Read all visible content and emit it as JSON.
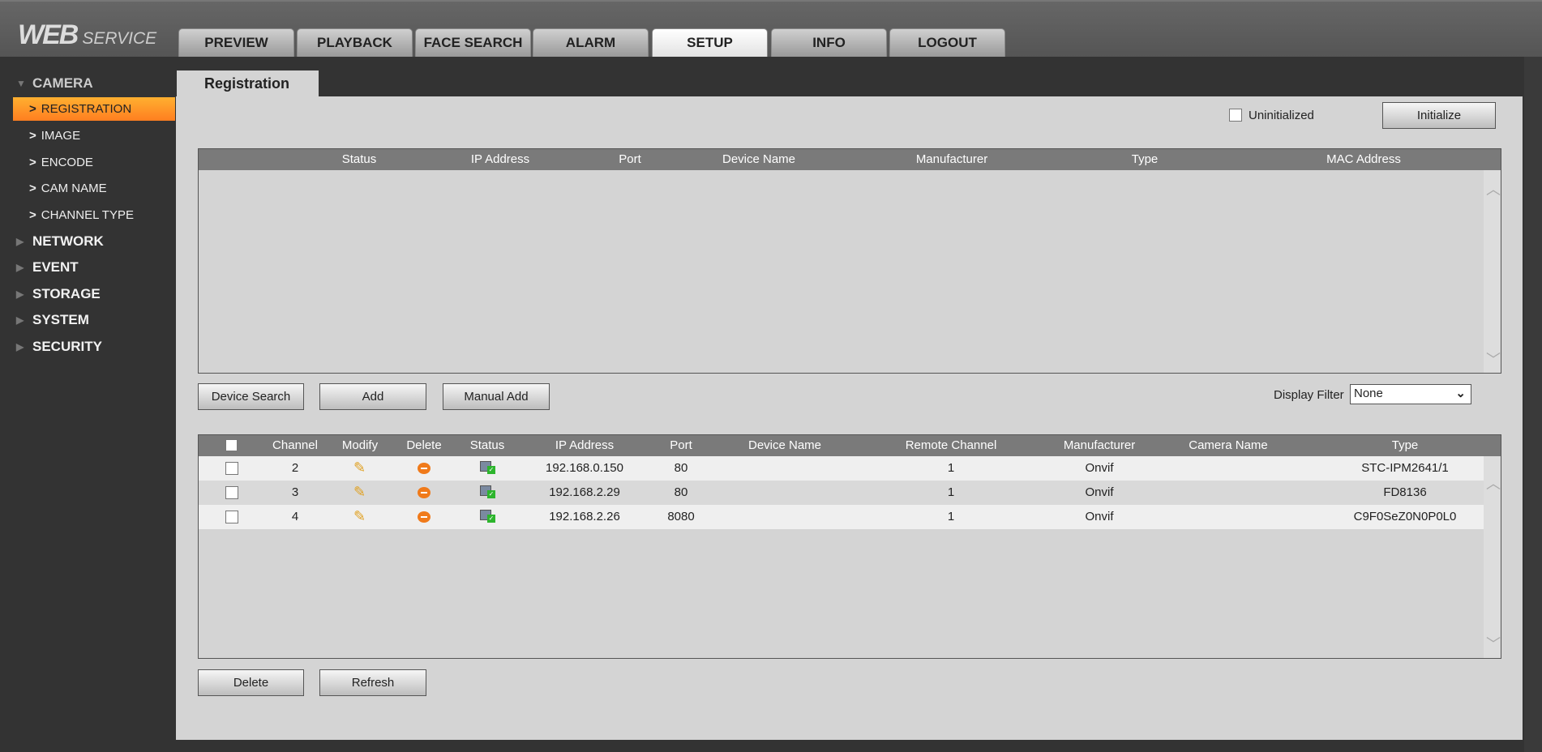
{
  "header": {
    "logo_main": "WEB",
    "logo_sub": "SERVICE",
    "tabs": [
      {
        "label": "PREVIEW"
      },
      {
        "label": "PLAYBACK"
      },
      {
        "label": "FACE SEARCH"
      },
      {
        "label": "ALARM"
      },
      {
        "label": "SETUP",
        "active": true
      },
      {
        "label": "INFO"
      },
      {
        "label": "LOGOUT"
      }
    ]
  },
  "sidebar": {
    "sections": [
      {
        "label": "CAMERA",
        "expanded": true,
        "items": [
          {
            "label": "REGISTRATION",
            "active": true
          },
          {
            "label": "IMAGE"
          },
          {
            "label": "ENCODE"
          },
          {
            "label": "CAM NAME"
          },
          {
            "label": "CHANNEL TYPE"
          }
        ]
      },
      {
        "label": "NETWORK"
      },
      {
        "label": "EVENT"
      },
      {
        "label": "STORAGE"
      },
      {
        "label": "SYSTEM"
      },
      {
        "label": "SECURITY"
      }
    ]
  },
  "page": {
    "tab": "Registration",
    "uninitialized_label": "Uninitialized",
    "uninitialized_checked": false,
    "initialize_label": "Initialize"
  },
  "search_table": {
    "columns": [
      "Status",
      "IP Address",
      "Port",
      "Device Name",
      "Manufacturer",
      "Type",
      "MAC Address"
    ],
    "rows": []
  },
  "actions": {
    "device_search": "Device Search",
    "add": "Add",
    "manual_add": "Manual Add",
    "display_filter_label": "Display Filter",
    "display_filter_value": "None"
  },
  "added_table": {
    "columns": [
      "Channel",
      "Modify",
      "Delete",
      "Status",
      "IP Address",
      "Port",
      "Device Name",
      "Remote Channel",
      "Manufacturer",
      "Camera Name",
      "Type"
    ],
    "rows": [
      {
        "channel": "2",
        "ip": "192.168.0.150",
        "port": "80",
        "device_name": "",
        "remote_channel": "1",
        "manufacturer": "Onvif",
        "camera_name": "",
        "type": "STC-IPM2641/1"
      },
      {
        "channel": "3",
        "ip": "192.168.2.29",
        "port": "80",
        "device_name": "",
        "remote_channel": "1",
        "manufacturer": "Onvif",
        "camera_name": "",
        "type": "FD8136"
      },
      {
        "channel": "4",
        "ip": "192.168.2.26",
        "port": "8080",
        "device_name": "",
        "remote_channel": "1",
        "manufacturer": "Onvif",
        "camera_name": "",
        "type": "C9F0SeZ0N0P0L0"
      }
    ]
  },
  "bottom": {
    "delete": "Delete",
    "refresh": "Refresh"
  },
  "colors": {
    "accent": "#ff9a28",
    "header_bg": "#7a7a7a",
    "panel": "#d4d4d4"
  }
}
